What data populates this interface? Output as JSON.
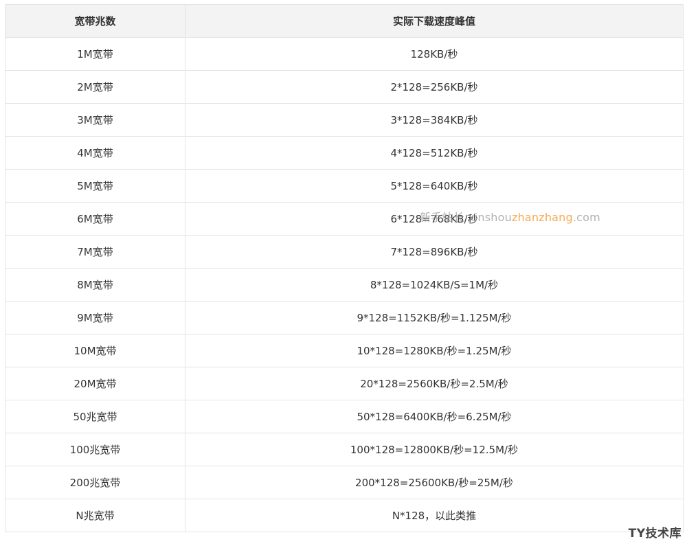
{
  "table": {
    "headers": [
      "宽带兆数",
      "实际下载速度峰值"
    ],
    "rows": [
      [
        "1M宽带",
        "128KB/秒"
      ],
      [
        "2M宽带",
        "2*128=256KB/秒"
      ],
      [
        "3M宽带",
        "3*128=384KB/秒"
      ],
      [
        "4M宽带",
        "4*128=512KB/秒"
      ],
      [
        "5M宽带",
        "5*128=640KB/秒"
      ],
      [
        "6M宽带",
        "6*128=768KB/秒"
      ],
      [
        "7M宽带",
        "7*128=896KB/秒"
      ],
      [
        "8M宽带",
        "8*128=1024KB/S=1M/秒"
      ],
      [
        "9M宽带",
        "9*128=1152KB/秒=1.125M/秒"
      ],
      [
        "10M宽带",
        "10*128=1280KB/秒=1.25M/秒"
      ],
      [
        "20M宽带",
        "20*128=2560KB/秒=2.5M/秒"
      ],
      [
        "50兆宽带",
        "50*128=6400KB/秒=6.25M/秒"
      ],
      [
        "100兆宽带",
        "100*128=12800KB/秒=12.5M/秒"
      ],
      [
        "200兆宽带",
        "200*128=25600KB/秒=25M/秒"
      ],
      [
        "N兆宽带",
        "N*128，以此类推"
      ]
    ]
  },
  "watermark": {
    "part1": "新手站长 xinshou",
    "part2": "zhanzhang",
    "part3": ".com"
  },
  "corner_logo": "TY技术库"
}
